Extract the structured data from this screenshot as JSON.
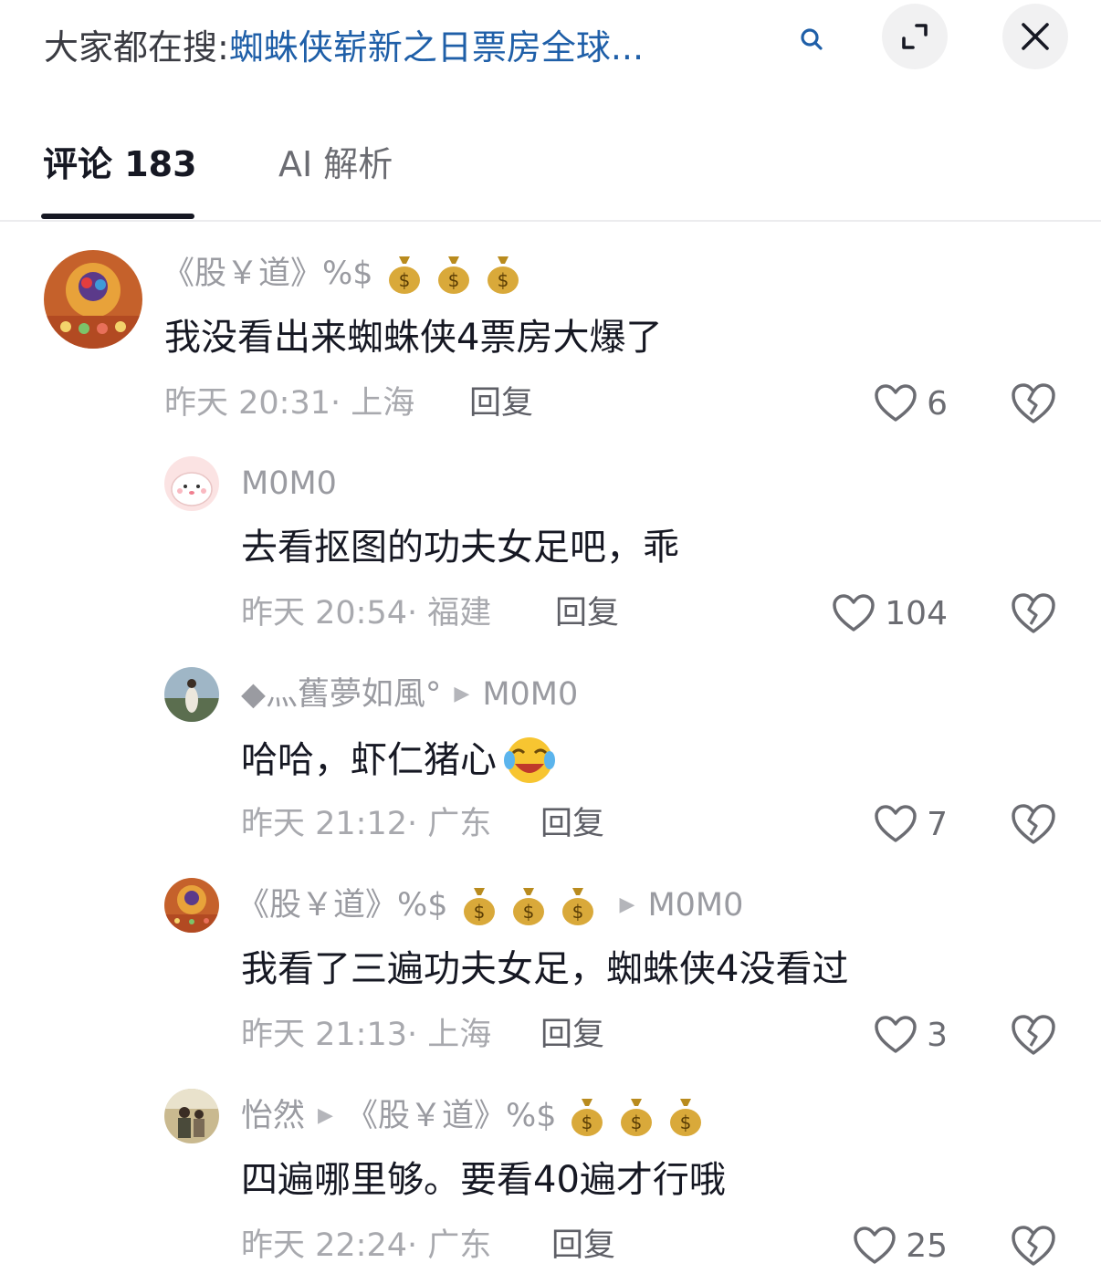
{
  "search": {
    "prefix": "大家都在搜:",
    "term": "蜘蛛侠崭新之日票房全球..."
  },
  "tabs": [
    {
      "label": "评论 183"
    },
    {
      "label": "AI 解析"
    }
  ],
  "comments": [
    {
      "author": "《股￥道》%$",
      "reply_to": "",
      "text": "我没看出来蜘蛛侠4票房大爆了",
      "time_location": "昨天 20:31· 上海",
      "reply_label": "回复",
      "likes": "6"
    },
    {
      "author": "M0M0",
      "reply_to": "",
      "text": "去看抠图的功夫女足吧，乖",
      "time_location": "昨天 20:54· 福建",
      "reply_label": "回复",
      "likes": "104"
    },
    {
      "author": "◆灬舊夢如風°",
      "reply_to": "M0M0",
      "text": "哈哈，虾仁猪心",
      "time_location": "昨天 21:12· 广东",
      "reply_label": "回复",
      "likes": "7"
    },
    {
      "author": "《股￥道》%$",
      "reply_to": "M0M0",
      "text": "我看了三遍功夫女足，蜘蛛侠4没看过",
      "time_location": "昨天 21:13· 上海",
      "reply_label": "回复",
      "likes": "3"
    },
    {
      "author": "怡然",
      "reply_to": "《股￥道》%$",
      "text": "四遍哪里够。要看40遍才行哦",
      "time_location": "昨天 22:24· 广东",
      "reply_label": "回复",
      "likes": "25"
    }
  ],
  "colors": {
    "search_term": "#1f5fa8",
    "text_primary": "#161823",
    "text_secondary": "#a8a9ae",
    "money_bag": "#c9a227"
  }
}
